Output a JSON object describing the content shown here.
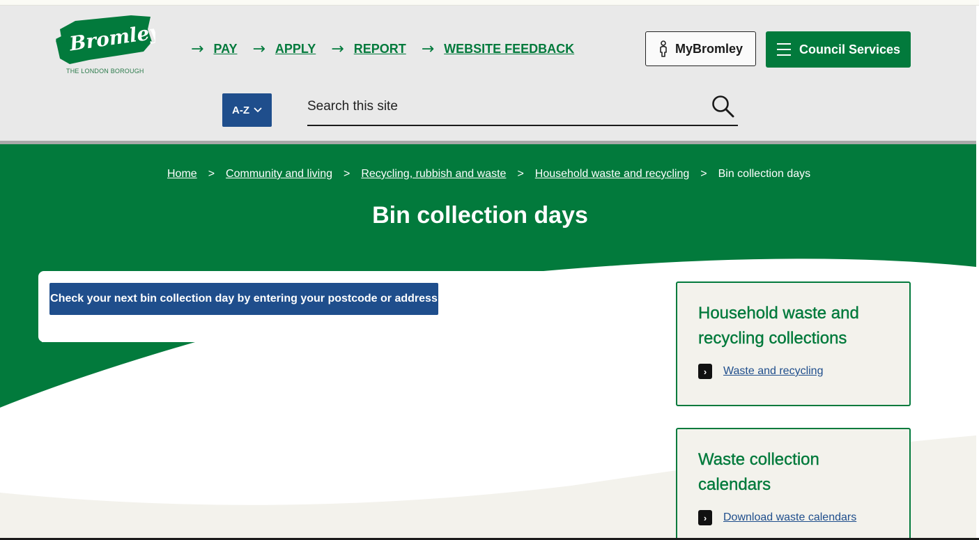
{
  "header": {
    "logo_text": "Bromley",
    "logo_subtitle": "THE LONDON BOROUGH",
    "quick_links": [
      {
        "label": "PAY"
      },
      {
        "label": "APPLY"
      },
      {
        "label": "REPORT"
      },
      {
        "label": "WEBSITE FEEDBACK"
      }
    ],
    "arrow_glyph": "→",
    "mybromley_label": "MyBromley",
    "council_services_label": "Council Services",
    "az_label": "A-Z",
    "search_placeholder": "Search this site"
  },
  "breadcrumb": {
    "items": [
      "Home",
      "Community and living",
      "Recycling, rubbish and waste",
      "Household waste and recycling"
    ],
    "separator": ">",
    "current": "Bin collection days"
  },
  "page_title": "Bin collection days",
  "main": {
    "check_button_label": "Check your next bin collection day by entering your postcode or address"
  },
  "side_cards": [
    {
      "title": "Household waste and recycling collections",
      "link_label": "Waste and recycling"
    },
    {
      "title": "Waste collection calendars",
      "link_label": "Download waste calendars"
    }
  ],
  "colors": {
    "brand_green": "#027a3c",
    "button_blue": "#1f4e8c",
    "header_grey": "#e9e9e9",
    "card_bg": "#f3f2ec"
  },
  "icons": {
    "search": "search-icon",
    "user": "person-icon",
    "menu": "hamburger-icon",
    "az_dropdown": "chevron-down-icon",
    "card_link": "chevron-right-icon"
  }
}
